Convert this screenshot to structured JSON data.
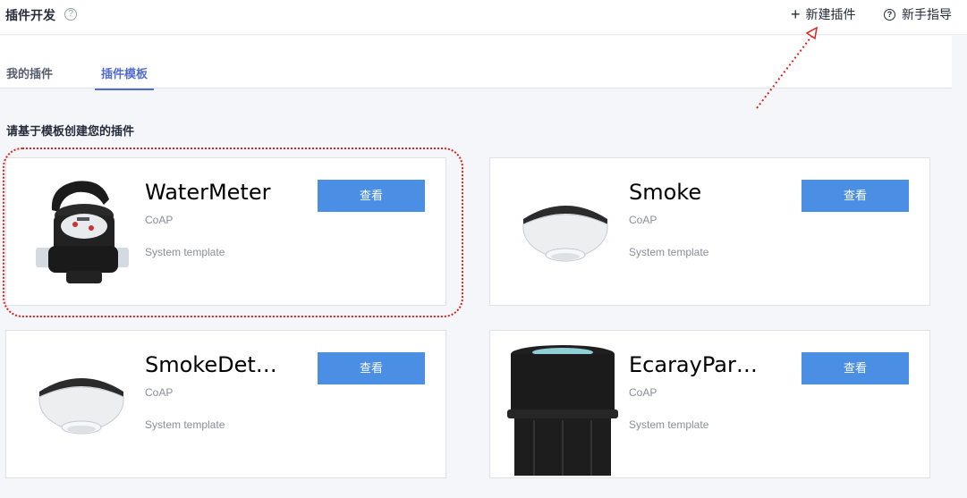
{
  "header": {
    "title": "插件开发",
    "help_glyph": "?",
    "new_plugin_label": "新建插件",
    "guide_label": "新手指导"
  },
  "tabs": [
    {
      "label": "我的插件",
      "active": false
    },
    {
      "label": "插件模板",
      "active": true
    }
  ],
  "section_title": "请基于模板创建您的插件",
  "cards": [
    {
      "name": "WaterMeter",
      "protocol": "CoAP",
      "template": "System template",
      "button": "查看",
      "icon": "water-meter-image"
    },
    {
      "name": "Smoke",
      "protocol": "CoAP",
      "template": "System template",
      "button": "查看",
      "icon": "smoke-detector-image"
    },
    {
      "name": "SmokeDet…",
      "protocol": "CoAP",
      "template": "System template",
      "button": "查看",
      "icon": "smoke-detector-image"
    },
    {
      "name": "EcarayPar…",
      "protocol": "CoAP",
      "template": "System template",
      "button": "查看",
      "icon": "parking-sensor-image"
    }
  ],
  "colors": {
    "accent": "#526ecc",
    "button": "#4a8fe4",
    "annotation": "#e0221e"
  }
}
